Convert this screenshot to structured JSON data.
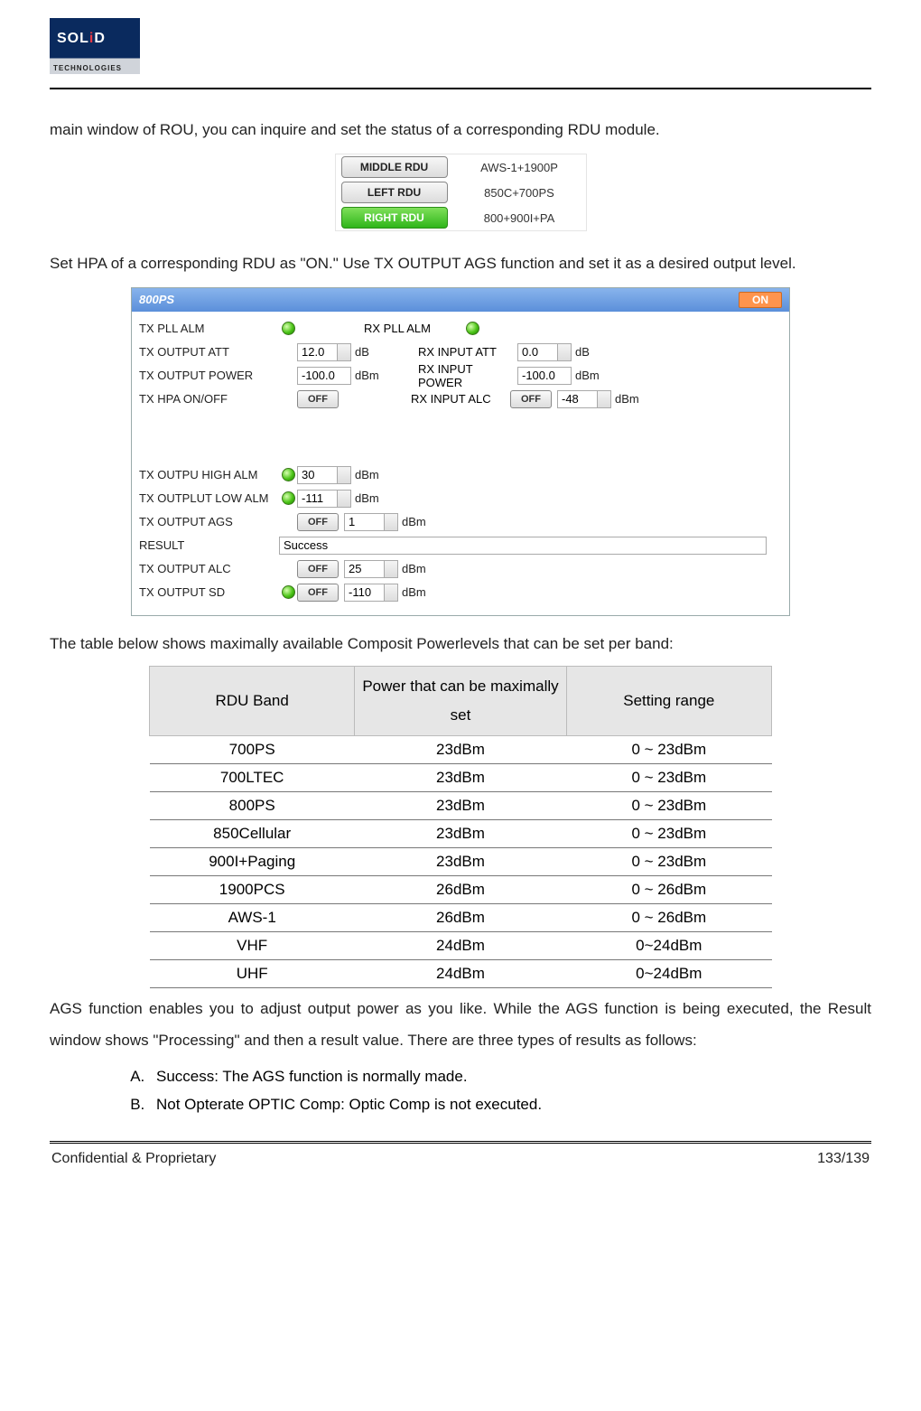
{
  "logo": {
    "brand_left": "S",
    "brand_o": "O",
    "brand_l": "L",
    "brand_i": "i",
    "brand_d": "D",
    "tag": "TECHNOLOGIES"
  },
  "p1": "main window of ROU, you can inquire and set the status of a corresponding RDU module.",
  "rdu_fig": {
    "rows": [
      {
        "btn": "MIDDLE RDU",
        "val": "AWS-1+1900P",
        "active": false
      },
      {
        "btn": "LEFT RDU",
        "val": "850C+700PS",
        "active": false
      },
      {
        "btn": "RIGHT RDU",
        "val": "800+900I+PA",
        "active": true
      }
    ]
  },
  "p2": "Set HPA of a corresponding RDU as \"ON.\" Use TX OUTPUT AGS function and set it as a desired output level.",
  "panel": {
    "title": "800PS",
    "on": "ON",
    "left": [
      {
        "label": "TX PLL ALM",
        "led": true
      },
      {
        "label": "TX OUTPUT ATT",
        "input": "12.0",
        "spin": true,
        "unit": "dB"
      },
      {
        "label": "TX OUTPUT POWER",
        "input": "-100.0",
        "unit": "dBm"
      },
      {
        "label": "TX HPA ON/OFF",
        "toggle": "OFF"
      }
    ],
    "right": [
      {
        "label": "RX PLL ALM",
        "led": true
      },
      {
        "label": "RX INPUT ATT",
        "input": "0.0",
        "spin": true,
        "unit": "dB"
      },
      {
        "label": "RX INPUT POWER",
        "input": "-100.0",
        "unit": "dBm"
      },
      {
        "label": "RX INPUT ALC",
        "toggle": "OFF",
        "input": "-48",
        "spin": true,
        "unit": "dBm"
      }
    ],
    "bottom": [
      {
        "label": "TX OUTPU HIGH ALM",
        "led": true,
        "input": "30",
        "spin": true,
        "unit": "dBm"
      },
      {
        "label": "TX OUTPLUT LOW ALM",
        "led": true,
        "input": "-111",
        "spin": true,
        "unit": "dBm"
      },
      {
        "label": "TX OUTPUT AGS",
        "toggle": "OFF",
        "input": "1",
        "spin": true,
        "unit": "dBm"
      },
      {
        "label": "RESULT",
        "wide": "Success"
      },
      {
        "label": "TX OUTPUT ALC",
        "toggle": "OFF",
        "input": "25",
        "spin": true,
        "unit": "dBm"
      },
      {
        "label": "TX OUTPUT SD",
        "led": true,
        "toggle": "OFF",
        "input": "-110",
        "spin": true,
        "unit": "dBm"
      }
    ]
  },
  "p3": "The table below shows maximally available Composit Powerlevels that can be set per band:",
  "chart_data": {
    "type": "table",
    "columns": [
      "RDU Band",
      "Power that can be maximally set",
      "Setting range"
    ],
    "rows": [
      [
        "700PS",
        "23dBm",
        "0 ~ 23dBm"
      ],
      [
        "700LTEC",
        "23dBm",
        "0 ~ 23dBm"
      ],
      [
        "800PS",
        "23dBm",
        "0 ~ 23dBm"
      ],
      [
        "850Cellular",
        "23dBm",
        "0 ~ 23dBm"
      ],
      [
        "900I+Paging",
        "23dBm",
        "0 ~ 23dBm"
      ],
      [
        "1900PCS",
        "26dBm",
        "0 ~ 26dBm"
      ],
      [
        "AWS-1",
        "26dBm",
        "0 ~ 26dBm"
      ],
      [
        "VHF",
        "24dBm",
        "0~24dBm"
      ],
      [
        "UHF",
        "24dBm",
        "0~24dBm"
      ]
    ]
  },
  "p4": "AGS function enables you to adjust output power as you like. While the AGS function is being executed, the Result window shows \"Processing\" and then a result value. There are three types of results as follows:",
  "results": [
    "Success: The AGS function is normally made.",
    "Not Opterate OPTIC Comp: Optic Comp is not executed."
  ],
  "footer": {
    "left": "Confidential & Proprietary",
    "right": "133/139"
  }
}
